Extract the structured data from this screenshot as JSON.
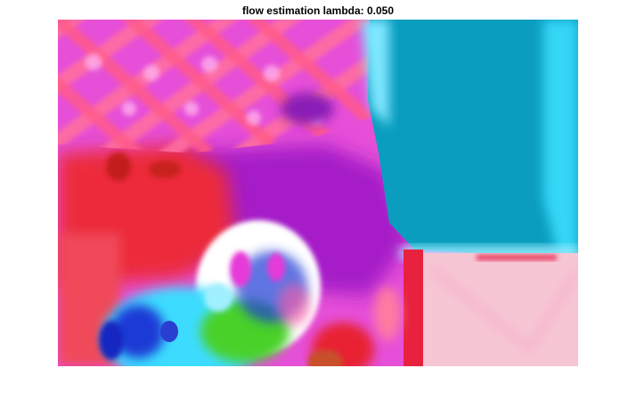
{
  "figure": {
    "title": "flow estimation lambda: 0.050",
    "colors": {
      "background": "#ffffff",
      "magenta": "#e64fd8",
      "purple": "#a51fc8",
      "red": "#ec2b3a",
      "cyan": "#0a9dbf",
      "light_cyan": "#34d6f6",
      "pink": "#f6c6d4",
      "green": "#4ad12a",
      "blue": "#1e3bd6"
    }
  }
}
